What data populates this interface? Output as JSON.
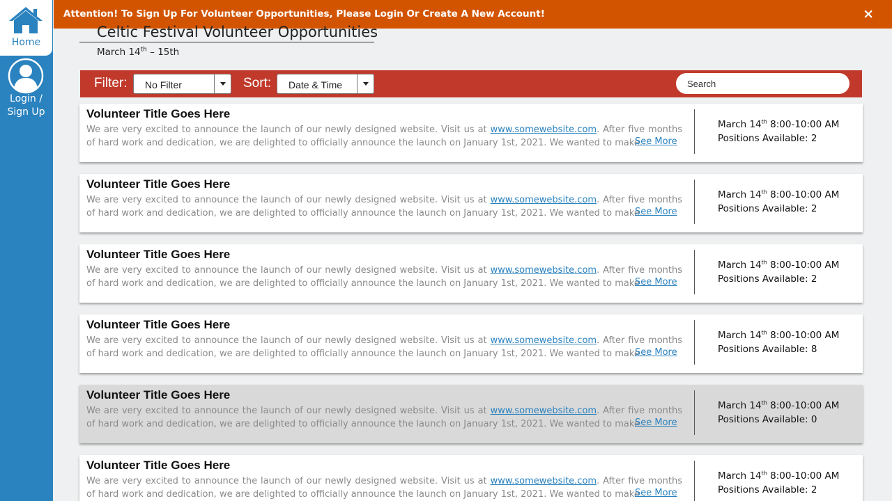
{
  "sidebar": {
    "home_label": "Home",
    "login_label": "Login /\nSign Up"
  },
  "alert": {
    "message": "Attention! To Sign Up For Volunteer Opportunities, Please Login Or Create A New Account!",
    "close": "×"
  },
  "header": {
    "title": "Celtic Festival Volunteer Opportunities",
    "date_start": "March 14",
    "date_start_sup": "th",
    "date_end": " – 15th"
  },
  "toolbar": {
    "filter_label": "Filter:",
    "filter_value": "No Filter",
    "sort_label": "Sort:",
    "sort_value": "Date & Time",
    "search_placeholder": "Search"
  },
  "colors": {
    "sidebar": "#2a82bf",
    "alert": "#d35400",
    "toolbar": "#c0392b",
    "link": "#2a82bf",
    "disabled_card": "#d9d9d9"
  },
  "opportunities": [
    {
      "title": "Volunteer Title Goes Here",
      "desc_before": "We are very excited to announce the launch of our newly designed website. Visit us at ",
      "link": "www.somewebsite.com",
      "desc_after": ".  After five months of hard work and dedication, we are delighted to officially announce the launch on January 1st, 2021. We wanted to make...",
      "see_more": "See More",
      "date": "March 14",
      "date_sup": "th",
      "time": " 8:00-10:00 AM",
      "positions": "Positions Available: 2",
      "disabled": false
    },
    {
      "title": "Volunteer Title Goes Here",
      "desc_before": "We are very excited to announce the launch of our newly designed website. Visit us at ",
      "link": "www.somewebsite.com",
      "desc_after": ".  After five months of hard work and dedication, we are delighted to officially announce the launch on January 1st, 2021. We wanted to make...",
      "see_more": "See More",
      "date": "March 14",
      "date_sup": "th",
      "time": " 8:00-10:00 AM",
      "positions": "Positions Available: 2",
      "disabled": false
    },
    {
      "title": "Volunteer Title Goes Here",
      "desc_before": "We are very excited to announce the launch of our newly designed website. Visit us at ",
      "link": "www.somewebsite.com",
      "desc_after": ".  After five months of hard work and dedication, we are delighted to officially announce the launch on January 1st, 2021. We wanted to make...",
      "see_more": "See More",
      "date": "March 14",
      "date_sup": "th",
      "time": " 8:00-10:00 AM",
      "positions": "Positions Available: 2",
      "disabled": false
    },
    {
      "title": "Volunteer Title Goes Here",
      "desc_before": "We are very excited to announce the launch of our newly designed website. Visit us at ",
      "link": "www.somewebsite.com",
      "desc_after": ".  After five months of hard work and dedication, we are delighted to officially announce the launch on January 1st, 2021. We wanted to make...",
      "see_more": "See More",
      "date": "March 14",
      "date_sup": "th",
      "time": " 8:00-10:00 AM",
      "positions": "Positions Available: 8",
      "disabled": false
    },
    {
      "title": "Volunteer Title Goes Here",
      "desc_before": "We are very excited to announce the launch of our newly designed website. Visit us at ",
      "link": "www.somewebsite.com",
      "desc_after": ".  After five months of hard work and dedication, we are delighted to officially announce the launch on January 1st, 2021. We wanted to make...",
      "see_more": "See More",
      "date": "March 14",
      "date_sup": "th",
      "time": " 8:00-10:00 AM",
      "positions": "Positions Available: 0",
      "disabled": true
    },
    {
      "title": "Volunteer Title Goes Here",
      "desc_before": "We are very excited to announce the launch of our newly designed website. Visit us at ",
      "link": "www.somewebsite.com",
      "desc_after": ".  After five months of hard work and dedication, we are delighted to officially announce the launch on January 1st, 2021. We wanted to make...",
      "see_more": "See More",
      "date": "March 14",
      "date_sup": "th",
      "time": " 8:00-10:00 AM",
      "positions": "Positions Available: 2",
      "disabled": false
    }
  ]
}
